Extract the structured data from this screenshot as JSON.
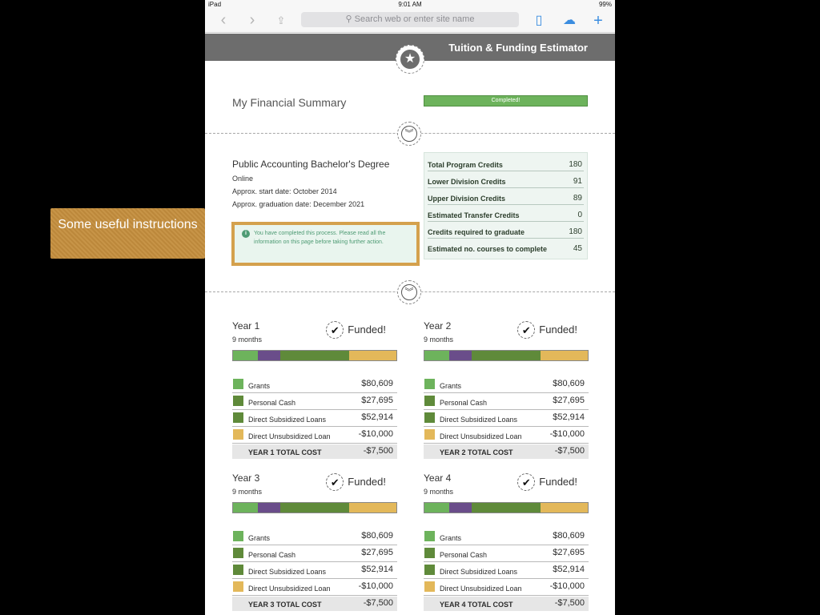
{
  "status_bar": {
    "device": "iPad",
    "time": "9:01 AM",
    "battery": "99%"
  },
  "browser": {
    "url_placeholder": "Search web or enter site name"
  },
  "header": {
    "title": "Tuition & Funding Estimator"
  },
  "summary": {
    "title": "My Financial Summary",
    "status": "Completed!",
    "progress": 1.0
  },
  "degree": {
    "title": "Public Accounting Bachelor's Degree",
    "mode": "Online",
    "start": "Approx. start date: October 2014",
    "graduation": "Approx. graduation date: December 2021"
  },
  "info": {
    "message": "You have completed this process. Please read all the information on this page before taking further action."
  },
  "credits": [
    {
      "label": "Total Program Credits",
      "value": "180"
    },
    {
      "label": "Lower Division Credits",
      "value": "91"
    },
    {
      "label": "Upper Division Credits",
      "value": "89"
    },
    {
      "label": "Estimated Transfer Credits",
      "value": "0"
    },
    {
      "label": "Credits required to graduate",
      "value": "180"
    },
    {
      "label": "Estimated no. courses to complete",
      "value": "45"
    }
  ],
  "colors": {
    "grants": "#6db35c",
    "personal_cash": "#6a8a3d",
    "direct_subsidized": "#6a8a3d",
    "direct_unsubsidized": "#e3b85a",
    "purple": "#6a4d8a",
    "callout": "#c48e3d"
  },
  "years": [
    {
      "title": "Year 1",
      "duration": "9 months",
      "status": "Funded!",
      "items": [
        {
          "label": "Grants",
          "value": "$80,609",
          "color": "#6db35c"
        },
        {
          "label": "Personal Cash",
          "value": "$27,695",
          "color": "#5f8a3a"
        },
        {
          "label": "Direct Subsidized Loans",
          "value": "$52,914",
          "color": "#5f8a3a"
        },
        {
          "label": "Direct Unsubsidized Loan",
          "value": "-$10,000",
          "color": "#e3b85a"
        }
      ],
      "total_label": "YEAR 1 TOTAL COST",
      "total_value": "-$7,500"
    },
    {
      "title": "Year 2",
      "duration": "9 months",
      "status": "Funded!",
      "items": [
        {
          "label": "Grants",
          "value": "$80,609",
          "color": "#6db35c"
        },
        {
          "label": "Personal Cash",
          "value": "$27,695",
          "color": "#5f8a3a"
        },
        {
          "label": "Direct Subsidized Loans",
          "value": "$52,914",
          "color": "#5f8a3a"
        },
        {
          "label": "Direct Unsubsidized Loan",
          "value": "-$10,000",
          "color": "#e3b85a"
        }
      ],
      "total_label": "YEAR 2 TOTAL COST",
      "total_value": "-$7,500"
    },
    {
      "title": "Year 3",
      "duration": "9 months",
      "status": "Funded!",
      "items": [
        {
          "label": "Grants",
          "value": "$80,609",
          "color": "#6db35c"
        },
        {
          "label": "Personal Cash",
          "value": "$27,695",
          "color": "#5f8a3a"
        },
        {
          "label": "Direct Subsidized Loans",
          "value": "$52,914",
          "color": "#5f8a3a"
        },
        {
          "label": "Direct Unsubsidized Loan",
          "value": "-$10,000",
          "color": "#e3b85a"
        }
      ],
      "total_label": "YEAR 3 TOTAL COST",
      "total_value": "-$7,500"
    },
    {
      "title": "Year 4",
      "duration": "9 months",
      "status": "Funded!",
      "items": [
        {
          "label": "Grants",
          "value": "$80,609",
          "color": "#6db35c"
        },
        {
          "label": "Personal Cash",
          "value": "$27,695",
          "color": "#5f8a3a"
        },
        {
          "label": "Direct Subsidized Loans",
          "value": "$52,914",
          "color": "#5f8a3a"
        },
        {
          "label": "Direct Unsubsidized Loan",
          "value": "-$10,000",
          "color": "#e3b85a"
        }
      ],
      "total_label": "YEAR 4 TOTAL COST",
      "total_value": "-$7,500"
    }
  ],
  "funding_bar_segments": [
    {
      "fraction": 0.15,
      "color": "#6db35c"
    },
    {
      "fraction": 0.14,
      "color": "#6a4d8a"
    },
    {
      "fraction": 0.42,
      "color": "#5f8a3a"
    },
    {
      "fraction": 0.29,
      "color": "#e3b85a"
    }
  ],
  "callout": {
    "text": "Some useful instructions"
  }
}
